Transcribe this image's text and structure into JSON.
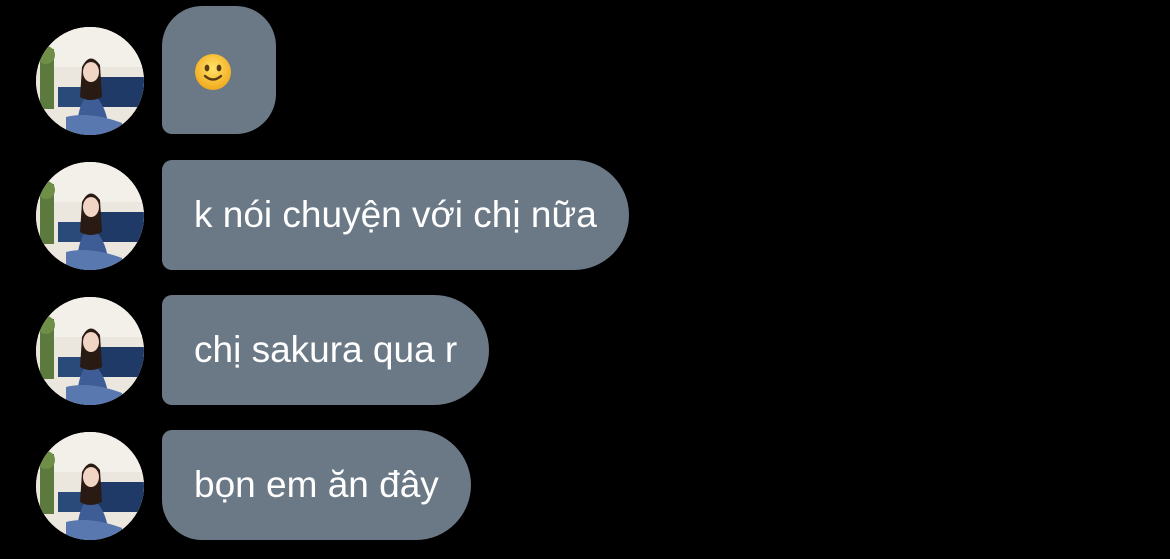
{
  "conversation": {
    "messages": [
      {
        "type": "emoji",
        "emoji": "🙂",
        "icon": "slightly-smiling-face-icon"
      },
      {
        "type": "text",
        "text": "k nói chuyện với chị nữa"
      },
      {
        "type": "text",
        "text": "chị sakura qua r"
      },
      {
        "type": "text",
        "text": "bọn em ăn đây"
      }
    ]
  },
  "colors": {
    "background": "#000000",
    "bubble": "#6b7886",
    "text": "#ffffff"
  }
}
